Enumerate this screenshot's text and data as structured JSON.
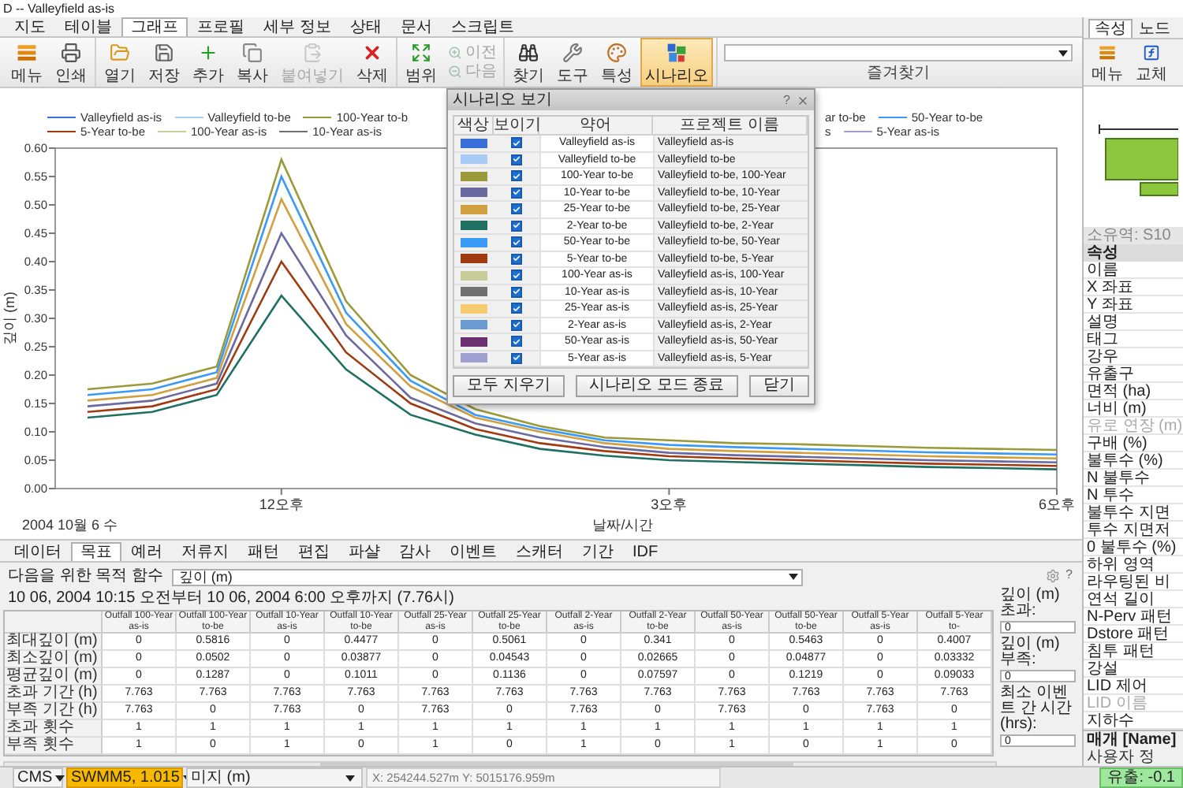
{
  "window": {
    "title": "D -- Valleyfield as-is"
  },
  "main_tabs": [
    {
      "label": "지도",
      "selected": false
    },
    {
      "label": "테이블",
      "selected": false
    },
    {
      "label": "그래프",
      "selected": true
    },
    {
      "label": "프로필",
      "selected": false
    },
    {
      "label": "세부 정보",
      "selected": false
    },
    {
      "label": "상태",
      "selected": false
    },
    {
      "label": "문서",
      "selected": false
    },
    {
      "label": "스크립트",
      "selected": false
    }
  ],
  "ribbon": {
    "groups": [
      {
        "items": [
          {
            "kind": "button",
            "label": "메뉴",
            "disabled": false,
            "active": false
          },
          {
            "kind": "button",
            "label": "인쇄",
            "disabled": false,
            "active": false
          }
        ]
      },
      {
        "items": [
          {
            "kind": "button",
            "label": "열기",
            "disabled": false,
            "active": false
          },
          {
            "kind": "button",
            "label": "저장",
            "disabled": false,
            "active": false
          },
          {
            "kind": "button",
            "label": "추가",
            "disabled": false,
            "active": false
          },
          {
            "kind": "button",
            "label": "복사",
            "disabled": false,
            "active": false
          },
          {
            "kind": "button",
            "label": "붙여넣기",
            "disabled": true,
            "active": false
          },
          {
            "kind": "button",
            "label": "삭제",
            "disabled": false,
            "active": false
          }
        ]
      },
      {
        "items": [
          {
            "kind": "button",
            "label": "범위",
            "disabled": false,
            "active": false
          },
          {
            "kind": "stack",
            "items": [
              {
                "label": "이전",
                "disabled": true
              },
              {
                "label": "다음",
                "disabled": true
              }
            ]
          }
        ]
      },
      {
        "items": [
          {
            "kind": "button",
            "label": "찾기",
            "disabled": false,
            "active": false
          },
          {
            "kind": "button",
            "label": "도구",
            "disabled": false,
            "active": false
          },
          {
            "kind": "button",
            "label": "특성",
            "disabled": false,
            "active": false
          },
          {
            "kind": "button",
            "label": "시나리오",
            "disabled": false,
            "active": true
          }
        ]
      }
    ],
    "favorites": {
      "label": "즐겨찾기"
    }
  },
  "chart": {
    "legend": [
      {
        "left": [
          {
            "label": "Valleyfield as-is",
            "color": "#3a6fd8"
          },
          {
            "label": "Valleyfield to-be",
            "color": "#a8ccf5"
          },
          {
            "label": "100-Year to-b",
            "color": "#9a9a3a"
          }
        ],
        "right": [
          {
            "label": "ar to-be"
          },
          {
            "label": "50-Year to-be",
            "color": "#3a9af5"
          }
        ]
      },
      {
        "left": [
          {
            "label": "5-Year to-be",
            "color": "#a03a10"
          },
          {
            "label": "100-Year as-is",
            "color": "#c8cc98"
          },
          {
            "label": "10-Year as-is",
            "color": "#707070"
          }
        ],
        "right": [
          {
            "label": "s"
          },
          {
            "label": "5-Year as-is",
            "color": "#a0a0d0"
          }
        ]
      }
    ],
    "date_label": "2004 10월 6 수",
    "chart_data": {
      "type": "line",
      "xlabel": "날짜/시간",
      "ylabel": "깊이 (m)",
      "categories": [
        null,
        null,
        null,
        "12오후",
        null,
        null,
        null,
        null,
        null,
        "3오후",
        null,
        null,
        null,
        null,
        null,
        "6오후"
      ],
      "ylim": [
        0,
        0.6
      ],
      "yticks": [
        {
          "value": 0,
          "label": "0.00"
        },
        {
          "value": 0.05,
          "label": "0.05"
        },
        {
          "value": 0.1,
          "label": "0.10"
        },
        {
          "value": 0.15,
          "label": "0.15"
        },
        {
          "value": 0.2,
          "label": "0.20"
        },
        {
          "value": 0.25,
          "label": "0.25"
        },
        {
          "value": 0.3,
          "label": "0.30"
        },
        {
          "value": 0.35,
          "label": "0.35"
        },
        {
          "value": 0.4,
          "label": "0.40"
        },
        {
          "value": 0.45,
          "label": "0.45"
        },
        {
          "value": 0.5,
          "label": "0.50"
        },
        {
          "value": 0.55,
          "label": "0.55"
        },
        {
          "value": 0.6,
          "label": "0.60"
        }
      ],
      "series": [
        {
          "color": "#9a9a3a",
          "values": [
            0.175,
            0.185,
            0.215,
            0.58,
            0.33,
            0.2,
            0.14,
            0.11,
            0.09,
            0.085,
            0.08,
            0.078,
            0.075,
            0.072,
            0.07,
            0.068
          ]
        },
        {
          "color": "#3a9af5",
          "values": [
            0.165,
            0.175,
            0.205,
            0.55,
            0.31,
            0.19,
            0.13,
            0.105,
            0.085,
            0.077,
            0.073,
            0.07,
            0.067,
            0.064,
            0.062,
            0.06
          ]
        },
        {
          "color": "#d0a040",
          "values": [
            0.155,
            0.165,
            0.195,
            0.51,
            0.29,
            0.18,
            0.125,
            0.1,
            0.08,
            0.07,
            0.066,
            0.063,
            0.06,
            0.057,
            0.055,
            0.053
          ]
        },
        {
          "color": "#6a6aa0",
          "values": [
            0.145,
            0.155,
            0.185,
            0.45,
            0.27,
            0.16,
            0.115,
            0.09,
            0.073,
            0.063,
            0.059,
            0.056,
            0.053,
            0.05,
            0.048,
            0.046
          ]
        },
        {
          "color": "#a03a10",
          "values": [
            0.135,
            0.145,
            0.175,
            0.4,
            0.24,
            0.15,
            0.105,
            0.08,
            0.066,
            0.057,
            0.053,
            0.05,
            0.047,
            0.044,
            0.042,
            0.04
          ]
        },
        {
          "color": "#1e7060",
          "values": [
            0.125,
            0.135,
            0.165,
            0.34,
            0.21,
            0.13,
            0.095,
            0.07,
            0.058,
            0.05,
            0.047,
            0.044,
            0.041,
            0.038,
            0.036,
            0.034
          ]
        }
      ]
    }
  },
  "scenario_dialog": {
    "title": "시나리오 보기",
    "help": "?",
    "columns": [
      "색상",
      "보이기",
      "약어",
      "프로젝트 이름"
    ],
    "rows": [
      {
        "color": "#3a6fd8",
        "visible": true,
        "abbr": "Valleyfield as-is",
        "project": "Valleyfield as-is"
      },
      {
        "color": "#a8ccf5",
        "visible": true,
        "abbr": "Valleyfield to-be",
        "project": "Valleyfield to-be"
      },
      {
        "color": "#9a9a3a",
        "visible": true,
        "abbr": "100-Year to-be",
        "project": "Valleyfield to-be, 100-Year"
      },
      {
        "color": "#6a6aa0",
        "visible": true,
        "abbr": "10-Year to-be",
        "project": "Valleyfield to-be, 10-Year"
      },
      {
        "color": "#d0a040",
        "visible": true,
        "abbr": "25-Year to-be",
        "project": "Valleyfield to-be, 25-Year"
      },
      {
        "color": "#1e7060",
        "visible": true,
        "abbr": "2-Year to-be",
        "project": "Valleyfield to-be, 2-Year"
      },
      {
        "color": "#3a9af5",
        "visible": true,
        "abbr": "50-Year to-be",
        "project": "Valleyfield to-be, 50-Year"
      },
      {
        "color": "#a03a10",
        "visible": true,
        "abbr": "5-Year to-be",
        "project": "Valleyfield to-be, 5-Year"
      },
      {
        "color": "#c8cc98",
        "visible": true,
        "abbr": "100-Year as-is",
        "project": "Valleyfield as-is, 100-Year"
      },
      {
        "color": "#707070",
        "visible": true,
        "abbr": "10-Year as-is",
        "project": "Valleyfield as-is, 10-Year"
      },
      {
        "color": "#f5cc70",
        "visible": true,
        "abbr": "25-Year as-is",
        "project": "Valleyfield as-is, 25-Year"
      },
      {
        "color": "#6a9ad0",
        "visible": true,
        "abbr": "2-Year as-is",
        "project": "Valleyfield as-is, 2-Year"
      },
      {
        "color": "#6a3070",
        "visible": true,
        "abbr": "50-Year as-is",
        "project": "Valleyfield as-is, 50-Year"
      },
      {
        "color": "#a0a0d0",
        "visible": true,
        "abbr": "5-Year as-is",
        "project": "Valleyfield as-is, 5-Year"
      }
    ],
    "buttons": [
      "모두 지우기",
      "시나리오 모드 종료",
      "닫기"
    ]
  },
  "bottom_panel": {
    "tabs": [
      {
        "label": "데이터",
        "selected": false
      },
      {
        "label": "목표",
        "selected": true
      },
      {
        "label": "예러",
        "selected": false
      },
      {
        "label": "저류지",
        "selected": false
      },
      {
        "label": "패턴",
        "selected": false
      },
      {
        "label": "편집",
        "selected": false
      },
      {
        "label": "파샬",
        "selected": false
      },
      {
        "label": "감사",
        "selected": false
      },
      {
        "label": "이벤트",
        "selected": false
      },
      {
        "label": "스캐터",
        "selected": false
      },
      {
        "label": "기간",
        "selected": false
      },
      {
        "label": "IDF",
        "selected": false
      }
    ],
    "objective": {
      "label": "다음을 위한 목적 함수",
      "value": "깊이 (m)"
    },
    "help": "?",
    "range": "10 06, 2004 10:15 오전부터 10 06, 2004 6:00 오후까지 (7.76시)",
    "table": {
      "columns": [
        "Outfall 100-Year as-is",
        "Outfall 100-Year to-be",
        "Outfall 10-Year as-is",
        "Outfall 10-Year to-be",
        "Outfall 25-Year as-is",
        "Outfall 25-Year to-be",
        "Outfall 2-Year as-is",
        "Outfall 2-Year to-be",
        "Outfall 50-Year as-is",
        "Outfall 50-Year to-be",
        "Outfall 5-Year as-is",
        "Outfall 5-Year to-"
      ],
      "rows": [
        {
          "label": "최대깊이 (m)",
          "cells": [
            "0",
            "0.5816",
            "0",
            "0.4477",
            "0",
            "0.5061",
            "0",
            "0.341",
            "0",
            "0.5463",
            "0",
            "0.4007"
          ]
        },
        {
          "label": "최소깊이 (m)",
          "cells": [
            "0",
            "0.0502",
            "0",
            "0.03877",
            "0",
            "0.04543",
            "0",
            "0.02665",
            "0",
            "0.04877",
            "0",
            "0.03332"
          ]
        },
        {
          "label": "평균깊이 (m)",
          "cells": [
            "0",
            "0.1287",
            "0",
            "0.1011",
            "0",
            "0.1136",
            "0",
            "0.07597",
            "0",
            "0.1219",
            "0",
            "0.09033"
          ]
        },
        {
          "label": "초과 기간 (h)",
          "cells": [
            "7.763",
            "7.763",
            "7.763",
            "7.763",
            "7.763",
            "7.763",
            "7.763",
            "7.763",
            "7.763",
            "7.763",
            "7.763",
            "7.763"
          ]
        },
        {
          "label": "부족 기간 (h)",
          "cells": [
            "7.763",
            "0",
            "7.763",
            "0",
            "7.763",
            "0",
            "7.763",
            "0",
            "7.763",
            "0",
            "7.763",
            "0"
          ]
        },
        {
          "label": "초과 횟수",
          "cells": [
            "1",
            "1",
            "1",
            "1",
            "1",
            "1",
            "1",
            "1",
            "1",
            "1",
            "1",
            "1"
          ]
        },
        {
          "label": "부족 횟수",
          "cells": [
            "1",
            "0",
            "1",
            "0",
            "1",
            "0",
            "1",
            "0",
            "1",
            "0",
            "1",
            "0"
          ]
        }
      ]
    },
    "thresholds": [
      {
        "label": "깊이 (m) 초과:",
        "value": "0"
      },
      {
        "label": "깊이 (m) 부족:",
        "value": "0"
      },
      {
        "label": "최소 이벤트 간 시간 (hrs):",
        "value": "0"
      }
    ]
  },
  "side_tabs": [
    {
      "label": "속성",
      "selected": true
    },
    {
      "label": "노드",
      "selected": false
    }
  ],
  "side_toolbar": [
    "메뉴",
    "교체"
  ],
  "properties": {
    "caption": "소유역: S10",
    "header": "속성",
    "rows": [
      {
        "label": "이름",
        "disabled": false
      },
      {
        "label": "X 좌표",
        "disabled": false
      },
      {
        "label": "Y 좌표",
        "disabled": false
      },
      {
        "label": "설명",
        "disabled": false
      },
      {
        "label": "태그",
        "disabled": false
      },
      {
        "label": "강우",
        "disabled": false
      },
      {
        "label": "유출구",
        "disabled": false
      },
      {
        "label": "면적 (ha)",
        "disabled": false
      },
      {
        "label": "너비 (m)",
        "disabled": false
      },
      {
        "label": "유로 연장 (m)",
        "disabled": true
      },
      {
        "label": "구배 (%)",
        "disabled": false
      },
      {
        "label": "불투수 (%)",
        "disabled": false
      },
      {
        "label": "N 불투수",
        "disabled": false
      },
      {
        "label": "N 투수",
        "disabled": false
      },
      {
        "label": "불투수 지면",
        "disabled": false
      },
      {
        "label": "투수 지면저",
        "disabled": false
      },
      {
        "label": "0 불투수 (%)",
        "disabled": false
      },
      {
        "label": "하위 영역",
        "disabled": false
      },
      {
        "label": "라우팅된 비",
        "disabled": false
      },
      {
        "label": "연석 길이",
        "disabled": false
      },
      {
        "label": "N-Perv 패턴",
        "disabled": false
      },
      {
        "label": "Dstore 패턴",
        "disabled": false
      },
      {
        "label": "침투 패턴",
        "disabled": false
      },
      {
        "label": "강설",
        "disabled": false
      },
      {
        "label": "LID 제어",
        "disabled": false
      },
      {
        "label": "LID 이름",
        "disabled": true
      },
      {
        "label": "지하수",
        "disabled": false
      }
    ],
    "footer_title": "매개 [Name]",
    "footer_text": "사용자 정"
  },
  "status_bar": [
    {
      "kind": "dropdown",
      "text": "CMS",
      "highlighted": false
    },
    {
      "kind": "dropdown",
      "text": "SWMM5, 1.015",
      "highlighted": true
    },
    {
      "kind": "dropdown",
      "text": "미지 (m)",
      "highlighted": false
    },
    {
      "kind": "field",
      "text": "X: 254244.527m  Y: 5015176.959m"
    },
    {
      "kind": "indicator",
      "text": "유출: -0.1"
    }
  ]
}
